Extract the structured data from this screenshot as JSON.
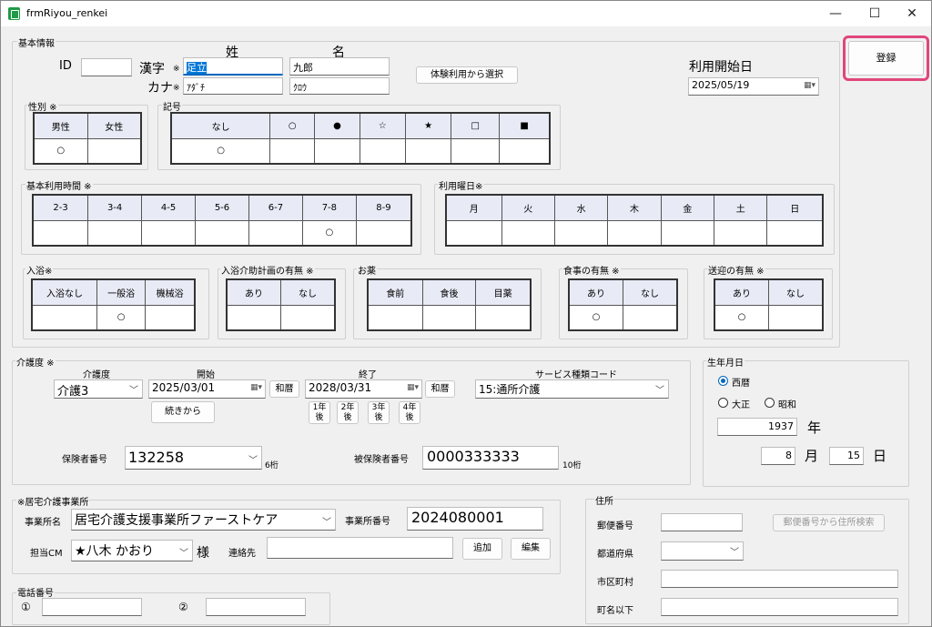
{
  "window": {
    "title": "frmRiyou_renkei",
    "min": "—",
    "max": "☐",
    "close": "✕"
  },
  "register_button": "登録",
  "kihon": {
    "legend": "基本情報",
    "id_label": "ID",
    "id_value": "",
    "sei_label": "姓",
    "mei_label": "名",
    "kanji_label": "漢字",
    "kana_label": "カナ",
    "req": "※",
    "kanji_sei": "足立",
    "kanji_mei": "九郎",
    "kana_sei": "ｱﾀﾞﾁ",
    "kana_mei": "ｸﾛｳ",
    "trial_button": "体験利用から選択",
    "start_label": "利用開始日",
    "start_date": "2025/05/19"
  },
  "gender": {
    "legend": "性別 ※",
    "headers": [
      "男性",
      "女性"
    ],
    "values": [
      "○",
      ""
    ]
  },
  "kigou": {
    "legend": "記号",
    "headers": [
      "なし",
      "○",
      "●",
      "☆",
      "★",
      "□",
      "■"
    ],
    "values": [
      "○",
      "",
      "",
      "",
      "",
      "",
      ""
    ]
  },
  "hours": {
    "legend": "基本利用時間 ※",
    "headers": [
      "2-3",
      "3-4",
      "4-5",
      "5-6",
      "6-7",
      "7-8",
      "8-9"
    ],
    "values": [
      "",
      "",
      "",
      "",
      "",
      "○",
      ""
    ]
  },
  "weekdays": {
    "legend": "利用曜日※",
    "headers": [
      "月",
      "火",
      "水",
      "木",
      "金",
      "土",
      "日"
    ],
    "values": [
      "",
      "",
      "",
      "",
      "",
      "",
      ""
    ]
  },
  "bath": {
    "legend": "入浴※",
    "headers": [
      "入浴なし",
      "一般浴",
      "機械浴"
    ],
    "values": [
      "",
      "○",
      ""
    ]
  },
  "bath_plan": {
    "legend": "入浴介助計画の有無 ※",
    "headers": [
      "あり",
      "なし"
    ],
    "values": [
      "",
      ""
    ]
  },
  "medicine": {
    "legend": "お薬",
    "headers": [
      "食前",
      "食後",
      "目薬"
    ],
    "values": [
      "",
      "",
      ""
    ]
  },
  "meal": {
    "legend": "食事の有無 ※",
    "headers": [
      "あり",
      "なし"
    ],
    "values": [
      "○",
      ""
    ]
  },
  "transport": {
    "legend": "送迎の有無 ※",
    "headers": [
      "あり",
      "なし"
    ],
    "values": [
      "○",
      ""
    ]
  },
  "care": {
    "legend": "介護度 ※",
    "level_label": "介護度",
    "level_value": "介護3",
    "start_label": "開始",
    "start_value": "2025/03/01",
    "end_label": "終了",
    "end_value": "2028/03/31",
    "wareki_button": "和暦",
    "continue_button": "続きから",
    "years": [
      "1年後",
      "2年後",
      "3年後",
      "4年後"
    ],
    "service_label": "サービス種類コード",
    "service_value": "15:通所介護",
    "insurer_label": "保険者番号",
    "insurer_value": "132258",
    "insurer_hint": "6桁",
    "insured_label": "被保険者番号",
    "insured_value": "0000333333",
    "insured_hint": "10桁"
  },
  "birth": {
    "legend": "生年月日",
    "seireki": "西暦",
    "taisho": "大正",
    "showa": "昭和",
    "year_value": "1937",
    "year_unit": "年",
    "month_value": "8",
    "month_unit": "月",
    "day_value": "15",
    "day_unit": "日"
  },
  "office": {
    "legend": "※居宅介護事業所",
    "name_label": "事業所名",
    "name_value": "居宅介護支援事業所ファーストケア",
    "number_label": "事業所番号",
    "number_value": "2024080001",
    "cm_label": "担当CM",
    "cm_value": "★八木 かおり",
    "sama": "様",
    "contact_label": "連絡先",
    "contact_value": "",
    "add_button": "追加",
    "edit_button": "編集"
  },
  "phone": {
    "legend": "電話番号",
    "label1": "①",
    "label2": "②",
    "value1": "",
    "value2": ""
  },
  "address": {
    "legend": "住所",
    "zip_label": "郵便番号",
    "zip_value": "",
    "zip_search_button": "郵便番号から住所検索",
    "pref_label": "都道府県",
    "pref_value": "",
    "city_label": "市区町村",
    "city_value": "",
    "town_label": "町名以下",
    "town_value": ""
  },
  "accent": "#e0467d"
}
